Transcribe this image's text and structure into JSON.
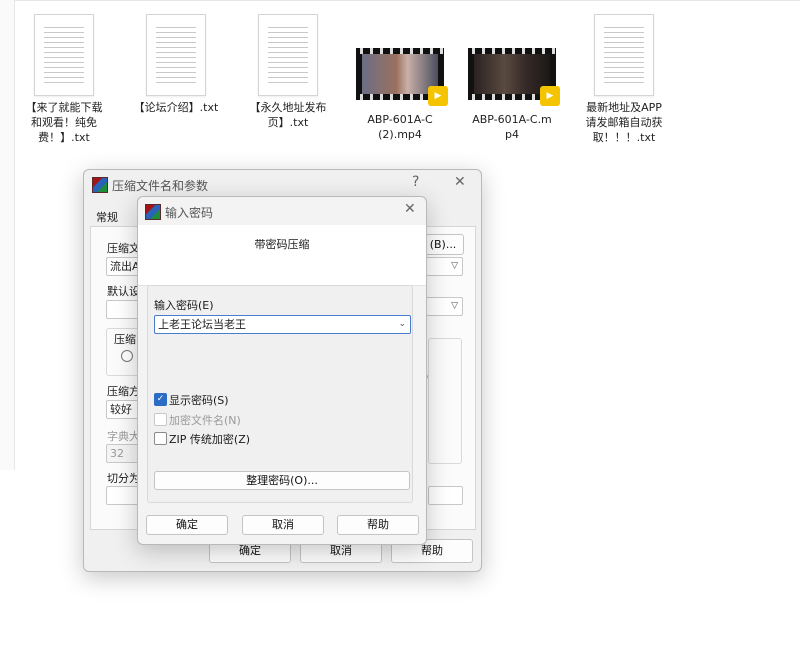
{
  "explorer": {
    "files": [
      {
        "name": "【来了就能下载和观看！纯免费！】.txt",
        "kind": "text"
      },
      {
        "name": "【论坛介绍】.txt",
        "kind": "text"
      },
      {
        "name": "【永久地址发布页】.txt",
        "kind": "text"
      },
      {
        "name": "ABP-601A-C(2).mp4",
        "kind": "video",
        "badge": "Potplayer"
      },
      {
        "name": "ABP-601A-C.mp4",
        "kind": "video",
        "badge": "Potplayer"
      },
      {
        "name": "最新地址及APP请发邮箱自动获取！！！.txt",
        "kind": "text"
      }
    ],
    "display_names": [
      "【来了就能下载\n和观看！纯免\n费！】.txt",
      "【论坛介绍】.txt",
      "【永久地址发布\n页】.txt",
      "ABP-601A-C\n(2).mp4",
      "ABP-601A-C.m\np4",
      "最新地址及APP\n请发邮箱自动获\n取！！！.txt"
    ]
  },
  "archive_dialog": {
    "title": "压缩文件名和参数",
    "help_glyph": "?",
    "close_glyph": "✕",
    "tab_general": "常规",
    "archive_name_label": "压缩文",
    "archive_name_value": "流出A",
    "browse_button": "(B)...",
    "default_profile_label": "默认设",
    "format_group_label": "压缩",
    "method_label": "压缩方",
    "method_value": "较好",
    "dict_label": "字典大",
    "dict_value": "32",
    "split_label": "切分为",
    "option_paren": ")",
    "ok": "确定",
    "cancel": "取消",
    "help": "帮助"
  },
  "password_dialog": {
    "title": "输入密码",
    "close_glyph": "✕",
    "heading": "带密码压缩",
    "password_label": "输入密码(E)",
    "password_value": "上老王论坛当老王",
    "show_password": "显示密码(S)",
    "encrypt_names": "加密文件名(N)",
    "zip_legacy": "ZIP 传统加密(Z)",
    "organize": "整理密码(O)...",
    "ok": "确定",
    "cancel": "取消",
    "help": "帮助",
    "show_password_checked": true,
    "encrypt_names_enabled": false
  },
  "colors": {
    "accent": "#2b6cc4",
    "dialog_bg": "#f0f0f0"
  },
  "icons": [
    "text-file-icon",
    "video-file-icon",
    "winrar-icon",
    "close-icon",
    "help-icon",
    "chevron-down-icon",
    "checkmark-icon"
  ]
}
